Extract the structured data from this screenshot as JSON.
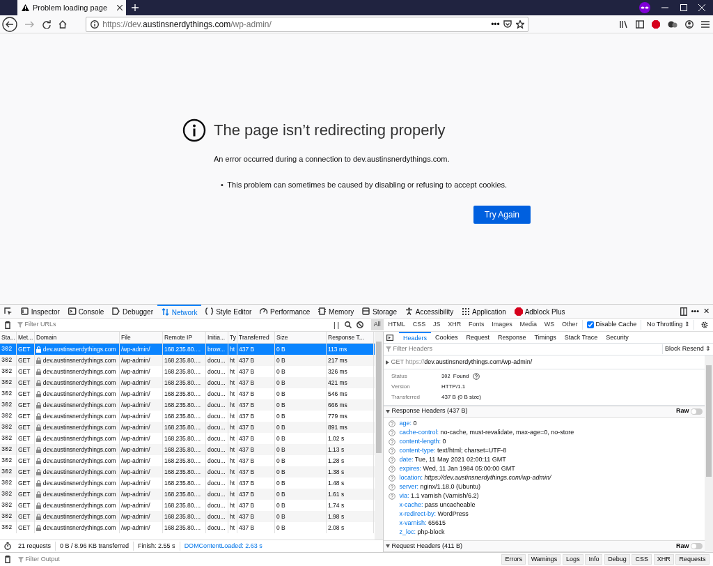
{
  "browser": {
    "tab": {
      "title": "Problem loading page",
      "selected": true
    },
    "url": {
      "lead": "https://dev.",
      "host": "austinsnerdythings.com",
      "path": "/wp-admin/"
    },
    "more": "•••"
  },
  "error_page": {
    "title": "The page isn’t redirecting properly",
    "message": "An error occurred during a connection to dev.austinsnerdythings.com.",
    "bullet_marker": "•",
    "bullets": [
      "This problem can sometimes be caused by disabling or refusing to accept cookies."
    ],
    "button": "Try Again"
  },
  "devtools": {
    "tools": [
      {
        "label": "Inspector",
        "selected": false
      },
      {
        "label": "Console",
        "selected": false
      },
      {
        "label": "Debugger",
        "selected": false
      },
      {
        "label": "Network",
        "selected": true
      },
      {
        "label": "Style Editor",
        "selected": false
      },
      {
        "label": "Performance",
        "selected": false
      },
      {
        "label": "Memory",
        "selected": false
      },
      {
        "label": "Storage",
        "selected": false
      },
      {
        "label": "Accessibility",
        "selected": false
      },
      {
        "label": "Application",
        "selected": false
      },
      {
        "label": "Adblock Plus",
        "selected": false
      }
    ],
    "more": "•••",
    "close": "✕",
    "filter_placeholder": "Filter URLs",
    "pause": "| |",
    "type_filters": [
      {
        "label": "All",
        "selected": true
      },
      {
        "label": "HTML",
        "selected": false
      },
      {
        "label": "CSS",
        "selected": false
      },
      {
        "label": "JS",
        "selected": false
      },
      {
        "label": "XHR",
        "selected": false
      },
      {
        "label": "Fonts",
        "selected": false
      },
      {
        "label": "Images",
        "selected": false
      },
      {
        "label": "Media",
        "selected": false
      },
      {
        "label": "WS",
        "selected": false
      },
      {
        "label": "Other",
        "selected": false
      }
    ],
    "disable_cache": {
      "label": "Disable Cache",
      "checked": true
    },
    "throttling": "No Throttling ⇕",
    "columns": [
      "Sta...",
      "Met...",
      "Domain",
      "File",
      "Remote IP",
      "Initia...",
      "Ty",
      "Transferred",
      "Size",
      "Response T..."
    ],
    "requests": [
      {
        "status": "302",
        "method": "GET",
        "domain": "dev.austinsnerdythings.com",
        "file": "/wp-admin/",
        "remote_ip": "168.235.80....",
        "initiator": "brow...",
        "type": "ht",
        "transferred": "437 B",
        "size": "0 B",
        "time": "113 ms",
        "selected": true
      },
      {
        "status": "302",
        "method": "GET",
        "domain": "dev.austinsnerdythings.com",
        "file": "/wp-admin/",
        "remote_ip": "168.235.80....",
        "initiator": "docu...",
        "type": "ht",
        "transferred": "437 B",
        "size": "0 B",
        "time": "217 ms",
        "selected": false
      },
      {
        "status": "302",
        "method": "GET",
        "domain": "dev.austinsnerdythings.com",
        "file": "/wp-admin/",
        "remote_ip": "168.235.80....",
        "initiator": "docu...",
        "type": "ht",
        "transferred": "437 B",
        "size": "0 B",
        "time": "326 ms",
        "selected": false
      },
      {
        "status": "302",
        "method": "GET",
        "domain": "dev.austinsnerdythings.com",
        "file": "/wp-admin/",
        "remote_ip": "168.235.80....",
        "initiator": "docu...",
        "type": "ht",
        "transferred": "437 B",
        "size": "0 B",
        "time": "421 ms",
        "selected": false
      },
      {
        "status": "302",
        "method": "GET",
        "domain": "dev.austinsnerdythings.com",
        "file": "/wp-admin/",
        "remote_ip": "168.235.80....",
        "initiator": "docu...",
        "type": "ht",
        "transferred": "437 B",
        "size": "0 B",
        "time": "546 ms",
        "selected": false
      },
      {
        "status": "302",
        "method": "GET",
        "domain": "dev.austinsnerdythings.com",
        "file": "/wp-admin/",
        "remote_ip": "168.235.80....",
        "initiator": "docu...",
        "type": "ht",
        "transferred": "437 B",
        "size": "0 B",
        "time": "666 ms",
        "selected": false
      },
      {
        "status": "302",
        "method": "GET",
        "domain": "dev.austinsnerdythings.com",
        "file": "/wp-admin/",
        "remote_ip": "168.235.80....",
        "initiator": "docu...",
        "type": "ht",
        "transferred": "437 B",
        "size": "0 B",
        "time": "779 ms",
        "selected": false
      },
      {
        "status": "302",
        "method": "GET",
        "domain": "dev.austinsnerdythings.com",
        "file": "/wp-admin/",
        "remote_ip": "168.235.80....",
        "initiator": "docu...",
        "type": "ht",
        "transferred": "437 B",
        "size": "0 B",
        "time": "891 ms",
        "selected": false
      },
      {
        "status": "302",
        "method": "GET",
        "domain": "dev.austinsnerdythings.com",
        "file": "/wp-admin/",
        "remote_ip": "168.235.80....",
        "initiator": "docu...",
        "type": "ht",
        "transferred": "437 B",
        "size": "0 B",
        "time": "1.02 s",
        "selected": false
      },
      {
        "status": "302",
        "method": "GET",
        "domain": "dev.austinsnerdythings.com",
        "file": "/wp-admin/",
        "remote_ip": "168.235.80....",
        "initiator": "docu...",
        "type": "ht",
        "transferred": "437 B",
        "size": "0 B",
        "time": "1.13 s",
        "selected": false
      },
      {
        "status": "302",
        "method": "GET",
        "domain": "dev.austinsnerdythings.com",
        "file": "/wp-admin/",
        "remote_ip": "168.235.80....",
        "initiator": "docu...",
        "type": "ht",
        "transferred": "437 B",
        "size": "0 B",
        "time": "1.28 s",
        "selected": false
      },
      {
        "status": "302",
        "method": "GET",
        "domain": "dev.austinsnerdythings.com",
        "file": "/wp-admin/",
        "remote_ip": "168.235.80....",
        "initiator": "docu...",
        "type": "ht",
        "transferred": "437 B",
        "size": "0 B",
        "time": "1.38 s",
        "selected": false
      },
      {
        "status": "302",
        "method": "GET",
        "domain": "dev.austinsnerdythings.com",
        "file": "/wp-admin/",
        "remote_ip": "168.235.80....",
        "initiator": "docu...",
        "type": "ht",
        "transferred": "437 B",
        "size": "0 B",
        "time": "1.48 s",
        "selected": false
      },
      {
        "status": "302",
        "method": "GET",
        "domain": "dev.austinsnerdythings.com",
        "file": "/wp-admin/",
        "remote_ip": "168.235.80....",
        "initiator": "docu...",
        "type": "ht",
        "transferred": "437 B",
        "size": "0 B",
        "time": "1.61 s",
        "selected": false
      },
      {
        "status": "302",
        "method": "GET",
        "domain": "dev.austinsnerdythings.com",
        "file": "/wp-admin/",
        "remote_ip": "168.235.80....",
        "initiator": "docu...",
        "type": "ht",
        "transferred": "437 B",
        "size": "0 B",
        "time": "1.74 s",
        "selected": false
      },
      {
        "status": "302",
        "method": "GET",
        "domain": "dev.austinsnerdythings.com",
        "file": "/wp-admin/",
        "remote_ip": "168.235.80....",
        "initiator": "docu...",
        "type": "ht",
        "transferred": "437 B",
        "size": "0 B",
        "time": "1.98 s",
        "selected": false
      },
      {
        "status": "302",
        "method": "GET",
        "domain": "dev.austinsnerdythings.com",
        "file": "/wp-admin/",
        "remote_ip": "168.235.80....",
        "initiator": "docu...",
        "type": "ht",
        "transferred": "437 B",
        "size": "0 B",
        "time": "2.08 s",
        "selected": false
      }
    ],
    "summary": {
      "requests": "21 requests",
      "transferred": "0 B / 8.96 KB transferred",
      "finish": "Finish: 2.55 s",
      "dom_loaded": "DOMContentLoaded: 2.63 s"
    },
    "details": {
      "tabs": [
        {
          "label": "Headers",
          "selected": true
        },
        {
          "label": "Cookies",
          "selected": false
        },
        {
          "label": "Request",
          "selected": false
        },
        {
          "label": "Response",
          "selected": false
        },
        {
          "label": "Timings",
          "selected": false
        },
        {
          "label": "Stack Trace",
          "selected": false
        },
        {
          "label": "Security",
          "selected": false
        }
      ],
      "filter_placeholder": "Filter Headers",
      "block": "Block",
      "resend": "Resend ⇕",
      "request_line": {
        "method": "GET",
        "scheme": "https://",
        "rest": "dev.austinsnerdythings.com/wp-admin/"
      },
      "status": {
        "label": "Status",
        "code": "302",
        "text": "Found"
      },
      "fields": [
        {
          "label": "Version",
          "value": "HTTP/1.1"
        },
        {
          "label": "Transferred",
          "value": "437 B (0 B size)"
        }
      ],
      "response_headers": {
        "title": "Response Headers (437 B)",
        "expanded": true,
        "raw": "Raw",
        "raw_on": false,
        "headers": [
          {
            "name": "age:",
            "value": "0",
            "help": true,
            "kind": "text"
          },
          {
            "name": "cache-control:",
            "value": "no-cache, must-revalidate, max-age=0, no-store",
            "help": true,
            "kind": "text"
          },
          {
            "name": "content-length:",
            "value": "0",
            "help": true,
            "kind": "text"
          },
          {
            "name": "content-type:",
            "value": "text/html; charset=UTF-8",
            "help": true,
            "kind": "text"
          },
          {
            "name": "date:",
            "value": "Tue, 11 May 2021 02:00:11 GMT",
            "help": true,
            "kind": "text"
          },
          {
            "name": "expires:",
            "value": "Wed, 11 Jan 1984 05:00:00 GMT",
            "help": true,
            "kind": "text"
          },
          {
            "name": "location:",
            "value": "https://dev.austinsnerdythings.com/wp-admin/",
            "help": true,
            "kind": "url"
          },
          {
            "name": "server:",
            "value": "nginx/1.18.0 (Ubuntu)",
            "help": true,
            "kind": "text"
          },
          {
            "name": "via:",
            "value": "1.1 varnish (Varnish/6.2)",
            "help": true,
            "kind": "text"
          },
          {
            "name": "x-cache:",
            "value": "pass uncacheable",
            "help": false,
            "kind": "text"
          },
          {
            "name": "x-redirect-by:",
            "value": "WordPress",
            "help": false,
            "kind": "text"
          },
          {
            "name": "x-varnish:",
            "value": "65615",
            "help": false,
            "kind": "text"
          },
          {
            "name": "z_loc:",
            "value": "php-block",
            "help": false,
            "kind": "text"
          }
        ]
      },
      "request_headers": {
        "title": "Request Headers (411 B)",
        "expanded": true,
        "raw": "Raw",
        "raw_on": false
      }
    },
    "console": {
      "placeholder": "Filter Output",
      "levels": [
        {
          "label": "Errors",
          "selected": false
        },
        {
          "label": "Warnings",
          "selected": false
        },
        {
          "label": "Logs",
          "selected": false
        },
        {
          "label": "Info",
          "selected": false
        },
        {
          "label": "Debug",
          "selected": false
        },
        {
          "label": "CSS",
          "selected": false
        },
        {
          "label": "XHR",
          "selected": false
        },
        {
          "label": "Requests",
          "selected": false
        }
      ]
    }
  }
}
